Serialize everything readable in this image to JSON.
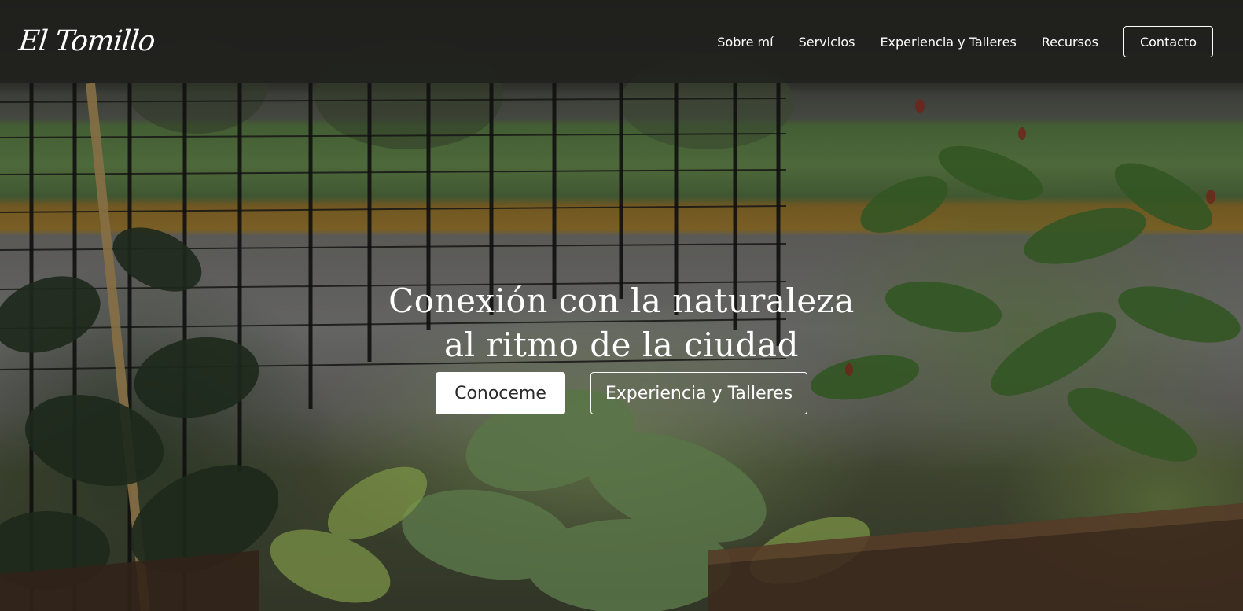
{
  "brand": {
    "logo_text": "El Tomillo"
  },
  "nav": {
    "items": [
      {
        "label": "Sobre mí"
      },
      {
        "label": "Servicios"
      },
      {
        "label": "Experiencia y Talleres"
      },
      {
        "label": "Recursos"
      }
    ],
    "contact_label": "Contacto"
  },
  "hero": {
    "title_line1": "Conexión con la naturaleza",
    "title_line2": "al ritmo de la ciudad",
    "primary_button": "Conoceme",
    "secondary_button": "Experiencia y Talleres"
  },
  "colors": {
    "header_bg": "#1e1e1c",
    "text": "#ffffff",
    "primary_button_bg": "#ffffff",
    "primary_button_text": "#2b2b2b"
  }
}
